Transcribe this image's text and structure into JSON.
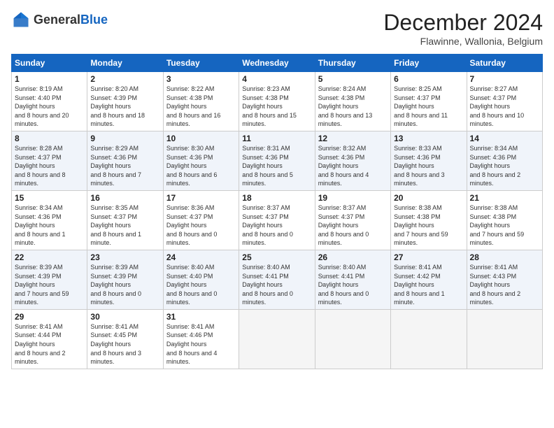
{
  "header": {
    "logo_general": "General",
    "logo_blue": "Blue",
    "month_title": "December 2024",
    "location": "Flawinne, Wallonia, Belgium"
  },
  "days_of_week": [
    "Sunday",
    "Monday",
    "Tuesday",
    "Wednesday",
    "Thursday",
    "Friday",
    "Saturday"
  ],
  "weeks": [
    [
      {
        "day": "1",
        "sunrise": "8:19 AM",
        "sunset": "4:40 PM",
        "daylight": "8 hours and 20 minutes."
      },
      {
        "day": "2",
        "sunrise": "8:20 AM",
        "sunset": "4:39 PM",
        "daylight": "8 hours and 18 minutes."
      },
      {
        "day": "3",
        "sunrise": "8:22 AM",
        "sunset": "4:38 PM",
        "daylight": "8 hours and 16 minutes."
      },
      {
        "day": "4",
        "sunrise": "8:23 AM",
        "sunset": "4:38 PM",
        "daylight": "8 hours and 15 minutes."
      },
      {
        "day": "5",
        "sunrise": "8:24 AM",
        "sunset": "4:38 PM",
        "daylight": "8 hours and 13 minutes."
      },
      {
        "day": "6",
        "sunrise": "8:25 AM",
        "sunset": "4:37 PM",
        "daylight": "8 hours and 11 minutes."
      },
      {
        "day": "7",
        "sunrise": "8:27 AM",
        "sunset": "4:37 PM",
        "daylight": "8 hours and 10 minutes."
      }
    ],
    [
      {
        "day": "8",
        "sunrise": "8:28 AM",
        "sunset": "4:37 PM",
        "daylight": "8 hours and 8 minutes."
      },
      {
        "day": "9",
        "sunrise": "8:29 AM",
        "sunset": "4:36 PM",
        "daylight": "8 hours and 7 minutes."
      },
      {
        "day": "10",
        "sunrise": "8:30 AM",
        "sunset": "4:36 PM",
        "daylight": "8 hours and 6 minutes."
      },
      {
        "day": "11",
        "sunrise": "8:31 AM",
        "sunset": "4:36 PM",
        "daylight": "8 hours and 5 minutes."
      },
      {
        "day": "12",
        "sunrise": "8:32 AM",
        "sunset": "4:36 PM",
        "daylight": "8 hours and 4 minutes."
      },
      {
        "day": "13",
        "sunrise": "8:33 AM",
        "sunset": "4:36 PM",
        "daylight": "8 hours and 3 minutes."
      },
      {
        "day": "14",
        "sunrise": "8:34 AM",
        "sunset": "4:36 PM",
        "daylight": "8 hours and 2 minutes."
      }
    ],
    [
      {
        "day": "15",
        "sunrise": "8:34 AM",
        "sunset": "4:36 PM",
        "daylight": "8 hours and 1 minute."
      },
      {
        "day": "16",
        "sunrise": "8:35 AM",
        "sunset": "4:37 PM",
        "daylight": "8 hours and 1 minute."
      },
      {
        "day": "17",
        "sunrise": "8:36 AM",
        "sunset": "4:37 PM",
        "daylight": "8 hours and 0 minutes."
      },
      {
        "day": "18",
        "sunrise": "8:37 AM",
        "sunset": "4:37 PM",
        "daylight": "8 hours and 0 minutes."
      },
      {
        "day": "19",
        "sunrise": "8:37 AM",
        "sunset": "4:37 PM",
        "daylight": "8 hours and 0 minutes."
      },
      {
        "day": "20",
        "sunrise": "8:38 AM",
        "sunset": "4:38 PM",
        "daylight": "7 hours and 59 minutes."
      },
      {
        "day": "21",
        "sunrise": "8:38 AM",
        "sunset": "4:38 PM",
        "daylight": "7 hours and 59 minutes."
      }
    ],
    [
      {
        "day": "22",
        "sunrise": "8:39 AM",
        "sunset": "4:39 PM",
        "daylight": "7 hours and 59 minutes."
      },
      {
        "day": "23",
        "sunrise": "8:39 AM",
        "sunset": "4:39 PM",
        "daylight": "8 hours and 0 minutes."
      },
      {
        "day": "24",
        "sunrise": "8:40 AM",
        "sunset": "4:40 PM",
        "daylight": "8 hours and 0 minutes."
      },
      {
        "day": "25",
        "sunrise": "8:40 AM",
        "sunset": "4:41 PM",
        "daylight": "8 hours and 0 minutes."
      },
      {
        "day": "26",
        "sunrise": "8:40 AM",
        "sunset": "4:41 PM",
        "daylight": "8 hours and 0 minutes."
      },
      {
        "day": "27",
        "sunrise": "8:41 AM",
        "sunset": "4:42 PM",
        "daylight": "8 hours and 1 minute."
      },
      {
        "day": "28",
        "sunrise": "8:41 AM",
        "sunset": "4:43 PM",
        "daylight": "8 hours and 2 minutes."
      }
    ],
    [
      {
        "day": "29",
        "sunrise": "8:41 AM",
        "sunset": "4:44 PM",
        "daylight": "8 hours and 2 minutes."
      },
      {
        "day": "30",
        "sunrise": "8:41 AM",
        "sunset": "4:45 PM",
        "daylight": "8 hours and 3 minutes."
      },
      {
        "day": "31",
        "sunrise": "8:41 AM",
        "sunset": "4:46 PM",
        "daylight": "8 hours and 4 minutes."
      },
      null,
      null,
      null,
      null
    ]
  ]
}
